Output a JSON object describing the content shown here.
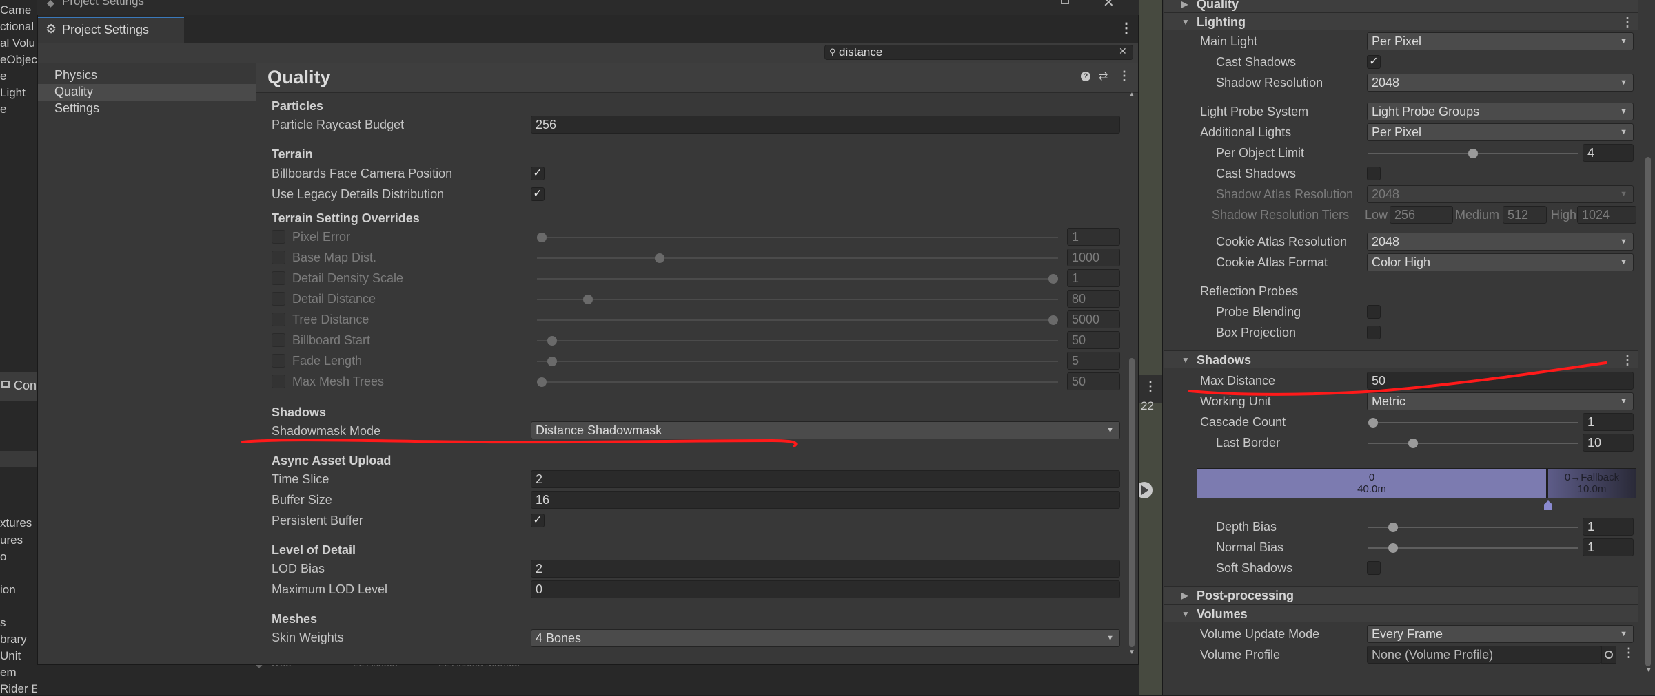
{
  "background": {
    "left_items": [
      "Came",
      "ctional",
      "al Volu",
      "eObjec",
      "e",
      "Light",
      "e"
    ],
    "console_tab": "Con",
    "lower_items": [
      "xtures",
      "ures",
      "o",
      "ion",
      "s",
      "brary",
      "Unit",
      "em",
      "Rider Editor"
    ],
    "counter": "22",
    "bottom_strip": [
      "Web",
      "LL Assets",
      "LL Assets Manual"
    ]
  },
  "window": {
    "title": "Project Settings",
    "tab_label": "Project Settings",
    "search_value": "distance"
  },
  "nav": {
    "items": [
      "Physics",
      "Quality",
      "Settings"
    ],
    "selected": "Quality"
  },
  "content": {
    "title": "Quality",
    "particles": {
      "header": "Particles",
      "raycast_budget_label": "Particle Raycast Budget",
      "raycast_budget_value": "256"
    },
    "terrain": {
      "header": "Terrain",
      "billboards_label": "Billboards Face Camera Position",
      "billboards_checked": true,
      "legacy_label": "Use Legacy Details Distribution",
      "legacy_checked": true
    },
    "terrain_overrides": {
      "header": "Terrain Setting Overrides",
      "rows": [
        {
          "label": "Pixel Error",
          "value": "1",
          "slider": 0.0
        },
        {
          "label": "Base Map Dist.",
          "value": "1000",
          "slider": 0.23
        },
        {
          "label": "Detail Density Scale",
          "value": "1",
          "slider": 1.0
        },
        {
          "label": "Detail Distance",
          "value": "80",
          "slider": 0.09
        },
        {
          "label": "Tree Distance",
          "value": "5000",
          "slider": 1.0
        },
        {
          "label": "Billboard Start",
          "value": "50",
          "slider": 0.02
        },
        {
          "label": "Fade Length",
          "value": "5",
          "slider": 0.02
        },
        {
          "label": "Max Mesh Trees",
          "value": "50",
          "slider": 0.0
        }
      ]
    },
    "shadows": {
      "header": "Shadows",
      "shadowmask_label": "Shadowmask Mode",
      "shadowmask_value": "Distance Shadowmask"
    },
    "async_upload": {
      "header": "Async Asset Upload",
      "time_slice_label": "Time Slice",
      "time_slice_value": "2",
      "buffer_size_label": "Buffer Size",
      "buffer_size_value": "16",
      "persistent_label": "Persistent Buffer",
      "persistent_checked": true
    },
    "lod": {
      "header": "Level of Detail",
      "lod_bias_label": "LOD Bias",
      "lod_bias_value": "2",
      "max_lod_label": "Maximum LOD Level",
      "max_lod_value": "0"
    },
    "meshes": {
      "header": "Meshes",
      "skin_weights_label": "Skin Weights",
      "skin_weights_value": "4 Bones"
    }
  },
  "inspector": {
    "quality_header": "Quality",
    "lighting": {
      "header": "Lighting",
      "main_light_label": "Main Light",
      "main_light_value": "Per Pixel",
      "cast_shadows_label": "Cast Shadows",
      "cast_shadows_checked": true,
      "shadow_res_label": "Shadow Resolution",
      "shadow_res_value": "2048",
      "light_probe_label": "Light Probe System",
      "light_probe_value": "Light Probe Groups",
      "additional_lights_label": "Additional Lights",
      "additional_lights_value": "Per Pixel",
      "per_object_label": "Per Object Limit",
      "per_object_value": "4",
      "per_object_slider": 0.5,
      "add_cast_shadows_label": "Cast Shadows",
      "add_cast_shadows_checked": false,
      "atlas_res_label": "Shadow Atlas Resolution",
      "atlas_res_value": "2048",
      "tiers_label": "Shadow Resolution Tiers",
      "tier_low_label": "Low",
      "tier_low_value": "256",
      "tier_medium_label": "Medium",
      "tier_medium_value": "512",
      "tier_high_label": "High",
      "tier_high_value": "1024",
      "cookie_res_label": "Cookie Atlas Resolution",
      "cookie_res_value": "2048",
      "cookie_format_label": "Cookie Atlas Format",
      "cookie_format_value": "Color High",
      "reflection_label": "Reflection Probes",
      "probe_blending_label": "Probe Blending",
      "box_projection_label": "Box Projection"
    },
    "shadows": {
      "header": "Shadows",
      "max_distance_label": "Max Distance",
      "max_distance_value": "50",
      "working_unit_label": "Working Unit",
      "working_unit_value": "Metric",
      "cascade_count_label": "Cascade Count",
      "cascade_count_value": "1",
      "cascade_count_slider": 0.0,
      "last_border_label": "Last Border",
      "last_border_value": "10",
      "last_border_slider": 0.2,
      "cascade0_index": "0",
      "cascade0_distance": "40.0m",
      "fallback_label": "0→Fallback",
      "fallback_distance": "10.0m",
      "depth_bias_label": "Depth Bias",
      "depth_bias_value": "1",
      "depth_bias_slider": 0.1,
      "normal_bias_label": "Normal Bias",
      "normal_bias_value": "1",
      "normal_bias_slider": 0.1,
      "soft_shadows_label": "Soft Shadows"
    },
    "post_processing_header": "Post-processing",
    "volumes": {
      "header": "Volumes",
      "update_mode_label": "Volume Update Mode",
      "update_mode_value": "Every Frame",
      "profile_label": "Volume Profile",
      "profile_value": "None (Volume Profile)"
    }
  },
  "colors": {
    "annotation": "#ff1a1a",
    "cascade": "#7c7bb0",
    "accent": "#3a79bb"
  }
}
